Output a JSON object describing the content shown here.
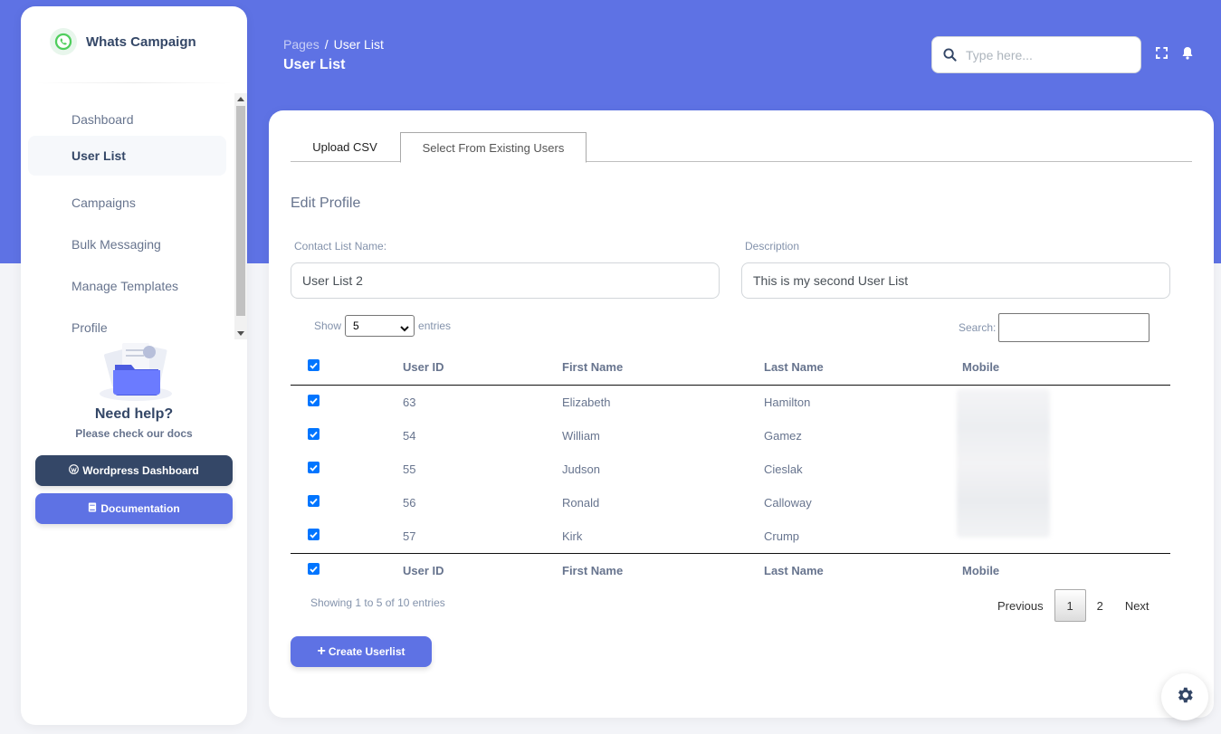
{
  "brand": {
    "name": "Whats Campaign",
    "logo_icon": "whatsapp-icon"
  },
  "sidebar": {
    "items": [
      {
        "label": "Dashboard",
        "active": false
      },
      {
        "label": "User List",
        "active": true
      },
      {
        "label": "Campaigns",
        "active": false
      },
      {
        "label": "Bulk Messaging",
        "active": false
      },
      {
        "label": "Manage Templates",
        "active": false
      },
      {
        "label": "Profile",
        "active": false
      }
    ],
    "help_title": "Need help?",
    "help_subtitle": "Please check our docs",
    "wp_button": "Wordpress Dashboard",
    "doc_button": "Documentation"
  },
  "header": {
    "breadcrumb_parent": "Pages",
    "breadcrumb_sep": "/",
    "breadcrumb_current": "User List",
    "title": "User List",
    "search_placeholder": "Type here..."
  },
  "tabs": [
    {
      "label": "Upload CSV"
    },
    {
      "label": "Select From Existing Users"
    }
  ],
  "form": {
    "title": "Edit Profile",
    "name_label": "Contact List Name:",
    "name_value": "User List 2",
    "desc_label": "Description",
    "desc_value": "This is my second User List"
  },
  "datatable": {
    "show_label": "Show",
    "entries_value": "5",
    "entries_label": "entries",
    "search_label": "Search:",
    "columns": [
      "User ID",
      "First Name",
      "Last Name",
      "Mobile"
    ],
    "rows": [
      {
        "id": "63",
        "first": "Elizabeth",
        "last": "Hamilton"
      },
      {
        "id": "54",
        "first": "William",
        "last": "Gamez"
      },
      {
        "id": "55",
        "first": "Judson",
        "last": "Cieslak"
      },
      {
        "id": "56",
        "first": "Ronald",
        "last": "Calloway"
      },
      {
        "id": "57",
        "first": "Kirk",
        "last": "Crump"
      }
    ],
    "info": "Showing 1 to 5 of 10 entries",
    "pager": {
      "prev": "Previous",
      "pages": [
        "1",
        "2"
      ],
      "current": "1",
      "next": "Next"
    }
  },
  "create_button": "Create Userlist",
  "colors": {
    "primary": "#5e72e4",
    "dark": "#344767",
    "text_muted": "#67748e",
    "checkbox": "#0075ff"
  }
}
